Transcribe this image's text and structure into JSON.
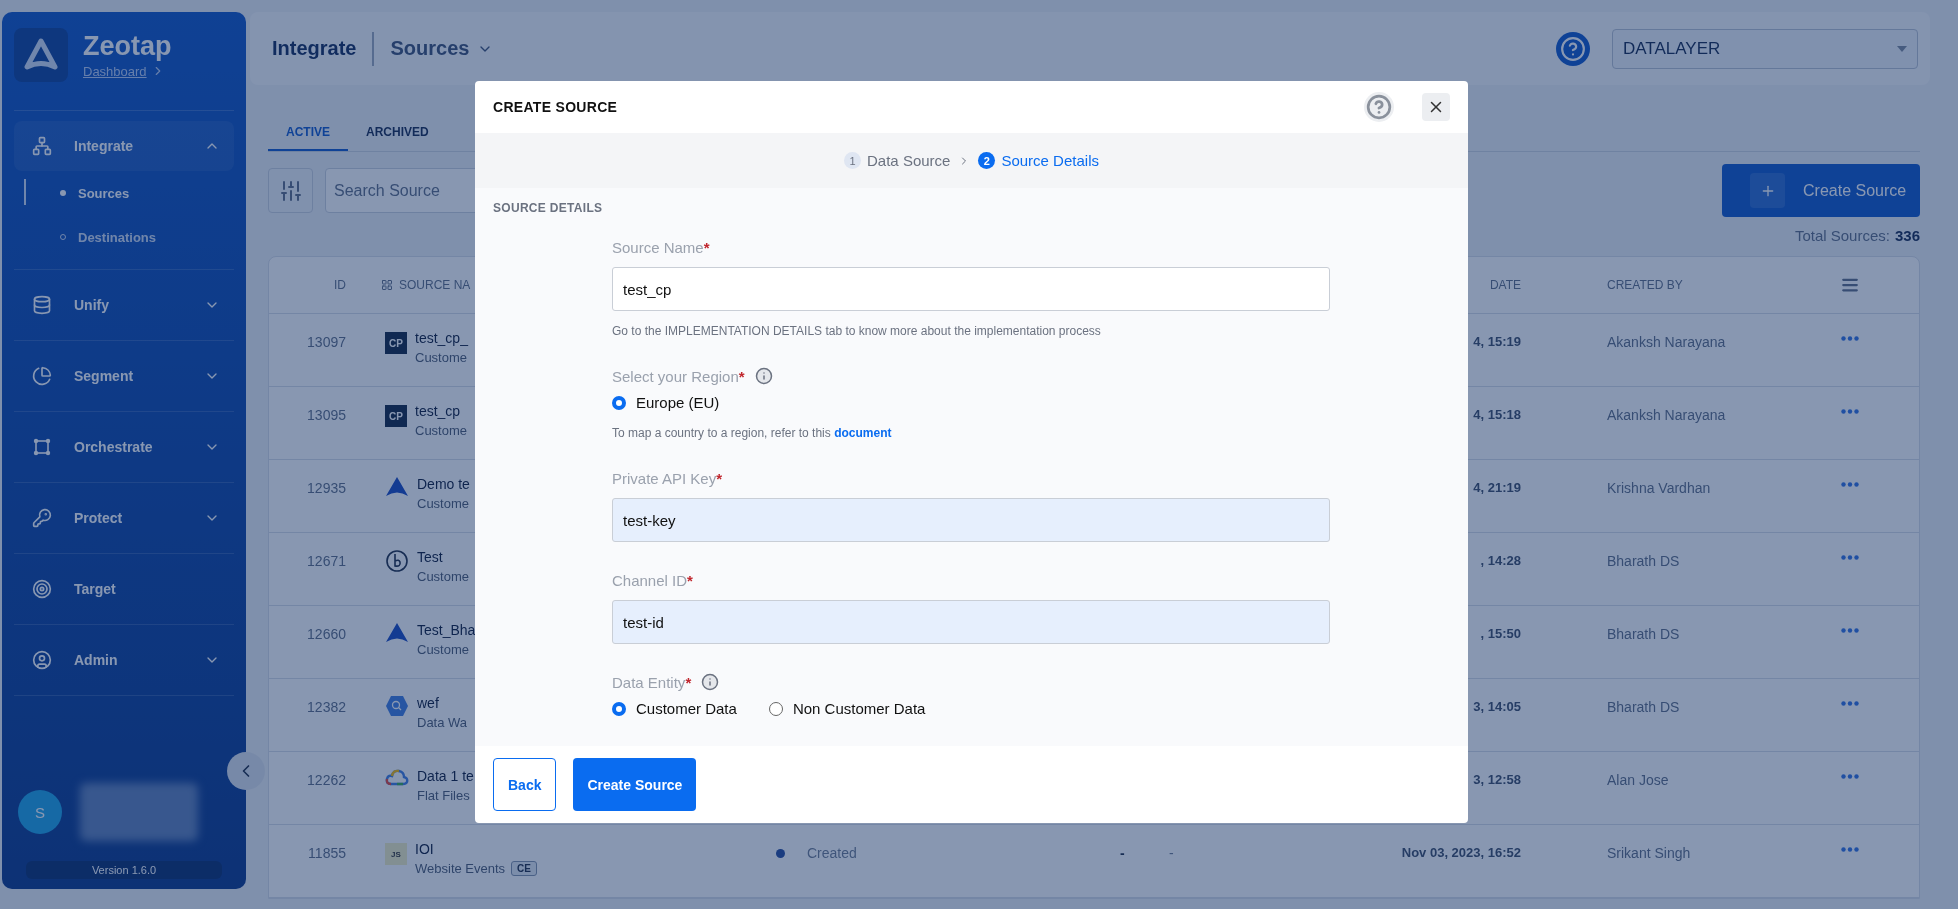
{
  "sidebar": {
    "brand": "Zeotap",
    "dashboard_link": "Dashboard",
    "nav": [
      {
        "label": "Integrate",
        "kind": "group",
        "expanded": true,
        "children": [
          {
            "label": "Sources",
            "selected": true
          },
          {
            "label": "Destinations",
            "selected": false
          }
        ]
      },
      {
        "label": "Unify",
        "kind": "group",
        "expanded": false
      },
      {
        "label": "Segment",
        "kind": "group",
        "expanded": false
      },
      {
        "label": "Orchestrate",
        "kind": "group",
        "expanded": false
      },
      {
        "label": "Protect",
        "kind": "group",
        "expanded": false
      },
      {
        "label": "Target",
        "kind": "link"
      },
      {
        "label": "Admin",
        "kind": "group",
        "expanded": false
      }
    ],
    "user": {
      "initial": "S"
    },
    "version": "Version 1.6.0"
  },
  "header": {
    "section": "Integrate",
    "page": "Sources",
    "workspace": "DATALAYER"
  },
  "tabs": [
    {
      "label": "ACTIVE",
      "selected": true
    },
    {
      "label": "ARCHIVED",
      "selected": false
    }
  ],
  "toolbar": {
    "search_placeholder": "Search Source",
    "create_button": "Create Source",
    "total_label": "Total Sources:",
    "total_value": "336"
  },
  "table": {
    "headers": {
      "id": "ID",
      "source_name": "SOURCE NA",
      "date": "DATE",
      "created_by": "CREATED BY"
    },
    "rows": [
      {
        "id": "13097",
        "name": "test_cp_",
        "type": "Custome",
        "logo": {
          "kind": "tile",
          "text": "CP"
        },
        "date": "4, 15:19",
        "created_by": "Akanksh Narayana"
      },
      {
        "id": "13095",
        "name": "test_cp",
        "type": "Custome",
        "logo": {
          "kind": "tile",
          "text": "CP"
        },
        "date": "4, 15:18",
        "created_by": "Akanksh Narayana"
      },
      {
        "id": "12935",
        "name": "Demo te",
        "type": "Custome",
        "logo": {
          "kind": "pyramid"
        },
        "date": "4, 21:19",
        "created_by": "Krishna Vardhan"
      },
      {
        "id": "12671",
        "name": "Test",
        "type": "Custome",
        "logo": {
          "kind": "circle-b"
        },
        "date": ", 14:28",
        "created_by": "Bharath DS"
      },
      {
        "id": "12660",
        "name": "Test_Bha",
        "type": "Custome",
        "logo": {
          "kind": "pyramid"
        },
        "date": ", 15:50",
        "created_by": "Bharath DS"
      },
      {
        "id": "12382",
        "name": "wef",
        "type": "Data Wa",
        "logo": {
          "kind": "hexagon"
        },
        "date": "3, 14:05",
        "created_by": "Bharath DS"
      },
      {
        "id": "12262",
        "name": "Data 1 te",
        "type": "Flat Files",
        "logo": {
          "kind": "cloud"
        },
        "date": "3, 12:58",
        "created_by": "Alan Jose"
      },
      {
        "id": "11855",
        "name": "IOI",
        "type": "Website Events",
        "badge": "CE",
        "logo": {
          "kind": "tile-light",
          "text": "JS"
        },
        "status": "Created",
        "color": "#1a3c80",
        "column_4": "-",
        "column_5": "-",
        "date": "Nov 03, 2023, 16:52",
        "created_by": "Srikant Singh"
      }
    ]
  },
  "modal": {
    "title": "CREATE SOURCE",
    "steps": [
      {
        "number": "1",
        "label": "Data Source",
        "selected": false
      },
      {
        "number": "2",
        "label": "Source Details",
        "selected": true
      }
    ],
    "section_title": "SOURCE DETAILS",
    "fields": [
      {
        "kind": "text",
        "label": "Source Name",
        "required_mark": "*",
        "info": false,
        "value": "test_cp",
        "autofilled": false,
        "hint": "Go to the IMPLEMENTATION DETAILS tab to know more about the implementation process"
      },
      {
        "kind": "radio",
        "label": "Select your Region",
        "required_mark": "*",
        "info": true,
        "options": [
          {
            "label": "Europe (EU)",
            "selected": true
          }
        ],
        "note": "To map a country to a region, refer to this",
        "note_link": "document"
      },
      {
        "kind": "text",
        "label": "Private API Key",
        "required_mark": "*",
        "info": false,
        "value": "test-key",
        "autofilled": true
      },
      {
        "kind": "text",
        "label": "Channel ID",
        "required_mark": "*",
        "info": false,
        "value": "test-id",
        "autofilled": true
      },
      {
        "kind": "radio",
        "label": "Data Entity",
        "required_mark": "*",
        "info": true,
        "options": [
          {
            "label": "Customer Data",
            "selected": true
          },
          {
            "label": "Non Customer Data",
            "selected": false
          }
        ]
      }
    ],
    "buttons": [
      {
        "label": "Back",
        "kind": "secondary"
      },
      {
        "label": "Create Source",
        "kind": "primary"
      }
    ]
  }
}
